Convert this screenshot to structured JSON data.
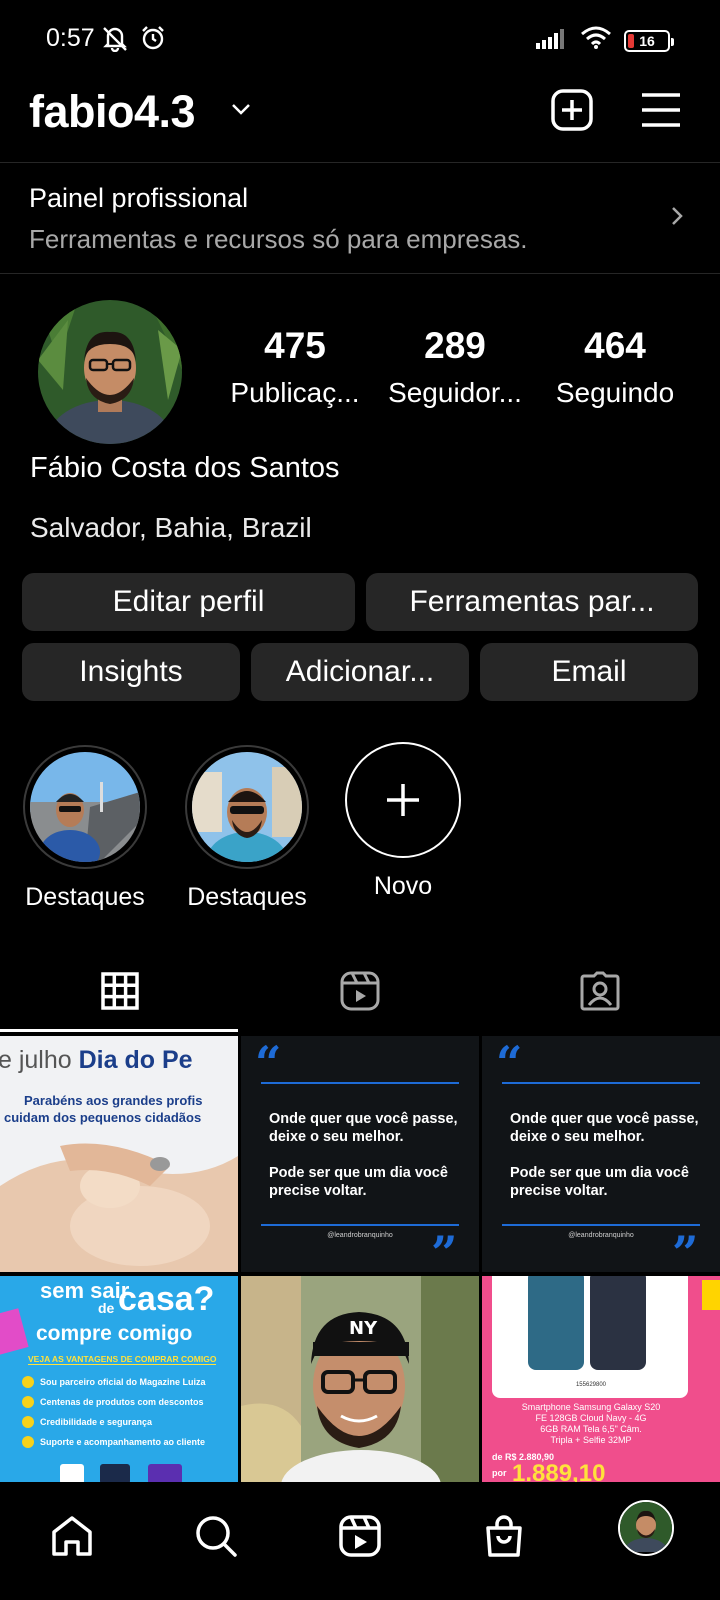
{
  "status_bar": {
    "time": "0:57",
    "battery": "16",
    "battery_color": "#e53935"
  },
  "header": {
    "username": "fabio4.3",
    "icons": [
      "chevron-down-icon",
      "plus-square-icon",
      "hamburger-menu-icon"
    ]
  },
  "pro_panel": {
    "title": "Painel profissional",
    "subtitle": "Ferramentas e recursos só para empresas."
  },
  "profile": {
    "full_name": "Fábio Costa dos Santos",
    "location": "Salvador, Bahia, Brazil",
    "stats": [
      {
        "value": "475",
        "label": "Publicaç..."
      },
      {
        "value": "289",
        "label": "Seguidor..."
      },
      {
        "value": "464",
        "label": "Seguindo"
      }
    ]
  },
  "actions": {
    "edit_profile": "Editar perfil",
    "tools": "Ferramentas par...",
    "insights": "Insights",
    "add": "Adicionar...",
    "email": "Email"
  },
  "highlights": [
    {
      "label": "Destaques"
    },
    {
      "label": "Destaques"
    },
    {
      "label": "Novo"
    }
  ],
  "tabs": [
    "grid-icon",
    "reels-icon",
    "tagged-icon"
  ],
  "posts": {
    "post1": {
      "line1_light": "e julho",
      "line1_bold": "Dia do Pe",
      "line2": "Parabéns aos grandes profis",
      "line3": "cuidam dos pequenos cidadãos"
    },
    "quote": {
      "text1": "Onde quer que você passe, deixe o seu melhor.",
      "text2": "Pode ser que um dia você precise voltar.",
      "handle": "@leandrobranquinho"
    },
    "post4": {
      "line1": "sem sair",
      "line2_small": "de",
      "line2_big": "casa?",
      "line3": "compre comigo",
      "banner": "VEJA AS VANTAGENS DE COMPRAR COMIGO",
      "bullets": [
        "Sou parceiro oficial do Magazine Luiza",
        "Centenas de produtos com descontos",
        "Credibilidade e segurança",
        "Suporte e acompanhamento ao cliente"
      ]
    },
    "post6": {
      "code": "155629800",
      "desc1": "Smartphone Samsung Galaxy S20",
      "desc2": "FE 128GB Cloud Navy - 4G",
      "desc3": "6GB RAM Tela 6,5\" Câm.",
      "desc4": "Tripla + Selfie 32MP",
      "old_price": "de R$ 2.880,90",
      "por": "por",
      "new_price": "1.889,10"
    }
  },
  "colors": {
    "background": "#000000",
    "button_bg": "#262626",
    "secondary_text": "#a8a8a8",
    "accent_blue": "#1e6bd6",
    "post4_bg": "#29a8e8",
    "post6_bg": "#f04e8c"
  }
}
